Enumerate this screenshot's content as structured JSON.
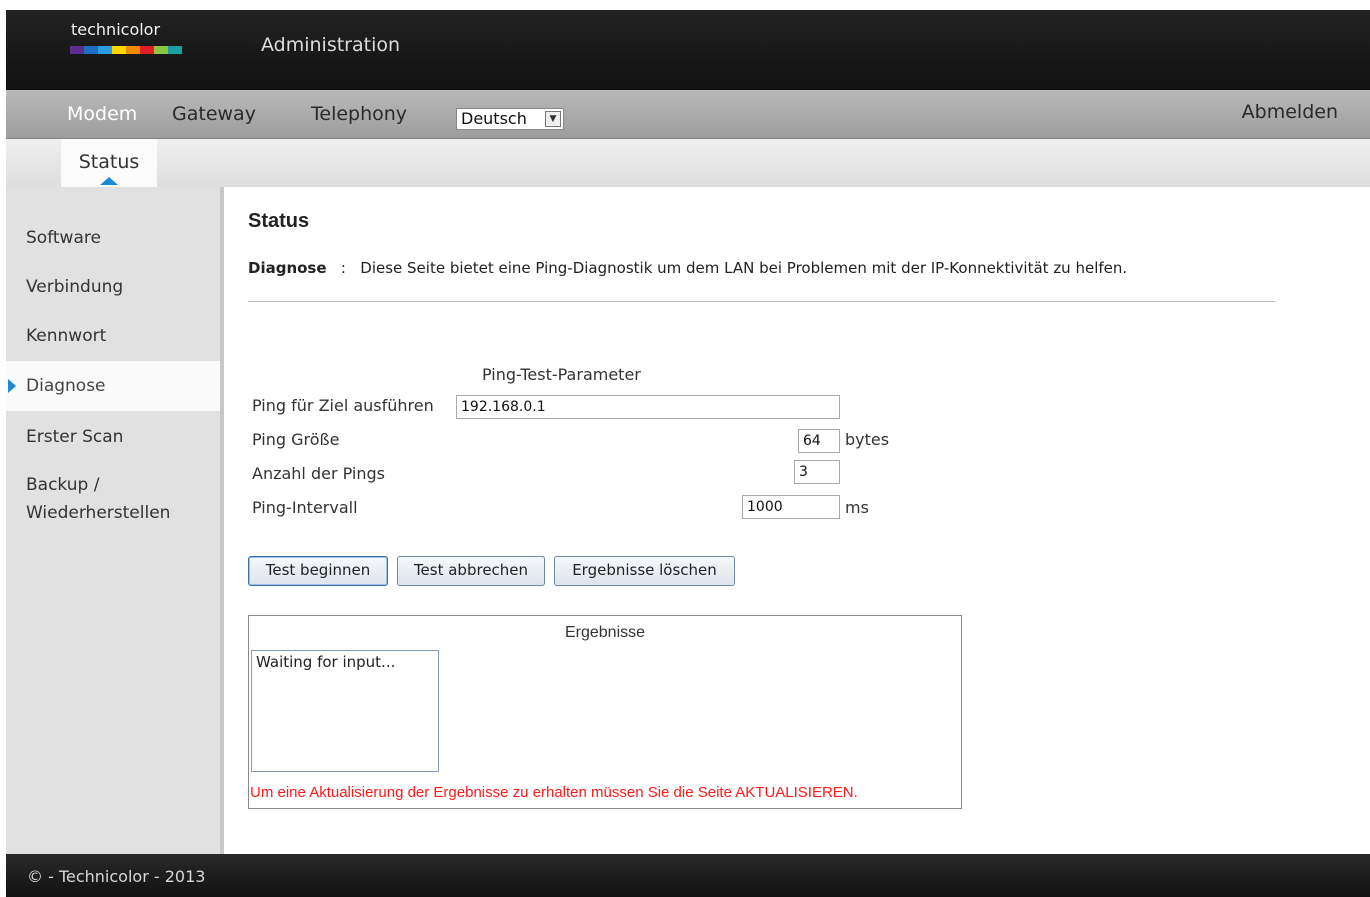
{
  "header": {
    "logo_text": "technicolor",
    "logo_colors": [
      "#5b2d8c",
      "#1c6fc4",
      "#2a9de0",
      "#ffd400",
      "#f08a00",
      "#e02020",
      "#8cc63f",
      "#1aa0a0"
    ],
    "title": "Administration"
  },
  "main_nav": {
    "items": [
      {
        "label": "Modem",
        "active": true
      },
      {
        "label": "Gateway"
      },
      {
        "label": "Telephony"
      }
    ],
    "language": "Deutsch",
    "logout_label": "Abmelden"
  },
  "sub_nav": {
    "tabs": [
      {
        "label": "Status",
        "active": true
      }
    ]
  },
  "sidebar": {
    "items": [
      {
        "label": "Software"
      },
      {
        "label": "Verbindung"
      },
      {
        "label": "Kennwort"
      },
      {
        "label": "Diagnose",
        "active": true
      },
      {
        "label": "Erster Scan"
      },
      {
        "label": "Backup / Wiederherstellen"
      }
    ]
  },
  "main": {
    "title": "Status",
    "desc_label": "Diagnose",
    "desc_separator": ":",
    "desc_text": "Diese Seite bietet eine Ping-Diagnostik um dem LAN bei Problemen mit der IP-Konnektivität zu helfen.",
    "ping_heading": "Ping-Test-Parameter",
    "fields": {
      "target": {
        "label": "Ping für Ziel ausführen",
        "value": "192.168.0.1"
      },
      "size": {
        "label": "Ping Größe",
        "value": "64",
        "unit": "bytes"
      },
      "count": {
        "label": "Anzahl der Pings",
        "value": "3"
      },
      "interval": {
        "label": "Ping-Intervall",
        "value": "1000",
        "unit": "ms"
      }
    },
    "buttons": {
      "start": "Test beginnen",
      "abort": "Test abbrechen",
      "clear": "Ergebnisse löschen"
    },
    "results": {
      "title": "Ergebnisse",
      "text": "Waiting for input...",
      "note": "Um eine Aktualisierung der Ergebnisse zu erhalten müssen Sie die Seite AKTUALISIEREN."
    }
  },
  "footer": {
    "text": "© - Technicolor - 2013"
  }
}
